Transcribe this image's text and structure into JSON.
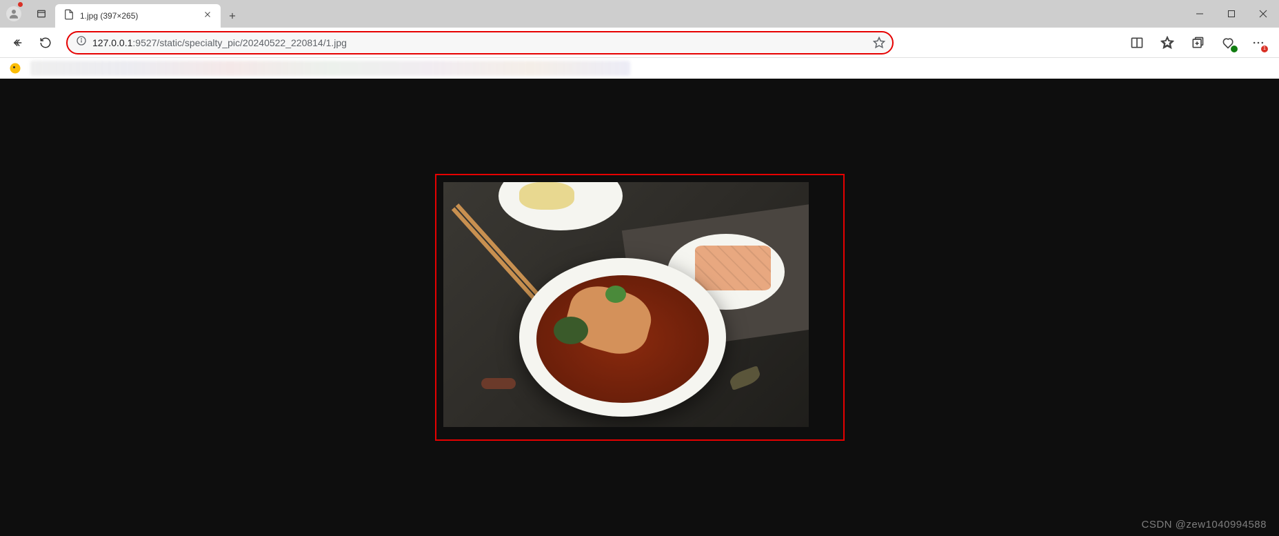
{
  "tab": {
    "title": "1.jpg (397×265)"
  },
  "url": {
    "host": "127.0.0.1",
    "path": ":9527/static/specialty_pic/20240522_220814/1.jpg"
  },
  "watermark": "CSDN @zew1040994588",
  "notification_badge": "1"
}
